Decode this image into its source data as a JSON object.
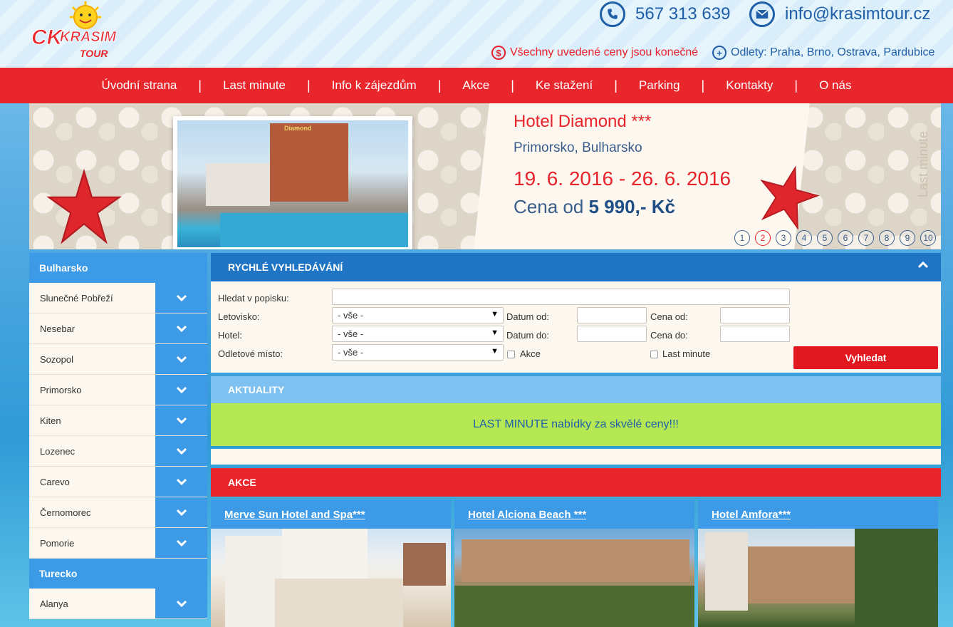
{
  "header": {
    "logo_text_ck": "CK",
    "logo_text_name": "KRASIM",
    "logo_text_tour": "TOUR",
    "phone": "567 313 639",
    "email": "info@krasimtour.cz",
    "price_note": "Všechny uvedené ceny jsou konečné",
    "flights_note": "Odlety: Praha, Brno, Ostrava, Pardubice"
  },
  "nav": {
    "items": [
      "Úvodní strana",
      "Last minute",
      "Info k zájezdům",
      "Akce",
      "Ke stažení",
      "Parking",
      "Kontakty",
      "O nás"
    ],
    "separator": "|"
  },
  "slider": {
    "hotel_name": "Hotel Diamond ***",
    "location": "Primorsko, Bulharsko",
    "dates": "19. 6. 2016 - 26. 6. 2016",
    "price_prefix": "Cena od ",
    "price": "5 990,- Kč",
    "vertical_label": "Last minute",
    "photo_sign": "Diamond",
    "pages": [
      "1",
      "2",
      "3",
      "4",
      "5",
      "6",
      "7",
      "8",
      "9",
      "10"
    ],
    "active_page": "2"
  },
  "sidebar": {
    "group1_title": "Bulharsko",
    "group1_items": [
      "Slunečné Pobřeží",
      "Nesebar",
      "Sozopol",
      "Primorsko",
      "Kiten",
      "Lozenec",
      "Carevo",
      "Černomorec",
      "Pomorie"
    ],
    "group2_title": "Turecko",
    "group2_items": [
      "Alanya"
    ]
  },
  "search": {
    "title": "RYCHLÉ VYHLEDÁVÁNÍ",
    "label_text": "Hledat v popisku:",
    "label_resort": "Letovisko:",
    "label_hotel": "Hotel:",
    "label_departure": "Odletové místo:",
    "select_default": "- vše -",
    "label_date_from": "Datum od:",
    "label_date_to": "Datum do:",
    "label_price_from": "Cena od:",
    "label_price_to": "Cena do:",
    "check_akce": "Akce",
    "check_lastminute": "Last minute",
    "button": "Vyhledat"
  },
  "news": {
    "title": "AKTUALITY",
    "message": "LAST MINUTE nabídky za skvělé ceny!!!"
  },
  "akce": {
    "title": "AKCE",
    "cards": [
      {
        "title": "Merve Sun Hotel and Spa***"
      },
      {
        "title": "Hotel Alciona Beach ***"
      },
      {
        "title": "Hotel Amfora***"
      }
    ]
  },
  "colors": {
    "brand_red": "#e8262c",
    "brand_blue": "#1f75c4",
    "light_blue": "#3d9ae6",
    "news_green": "#b5e853",
    "cream": "#fdf8ef"
  }
}
